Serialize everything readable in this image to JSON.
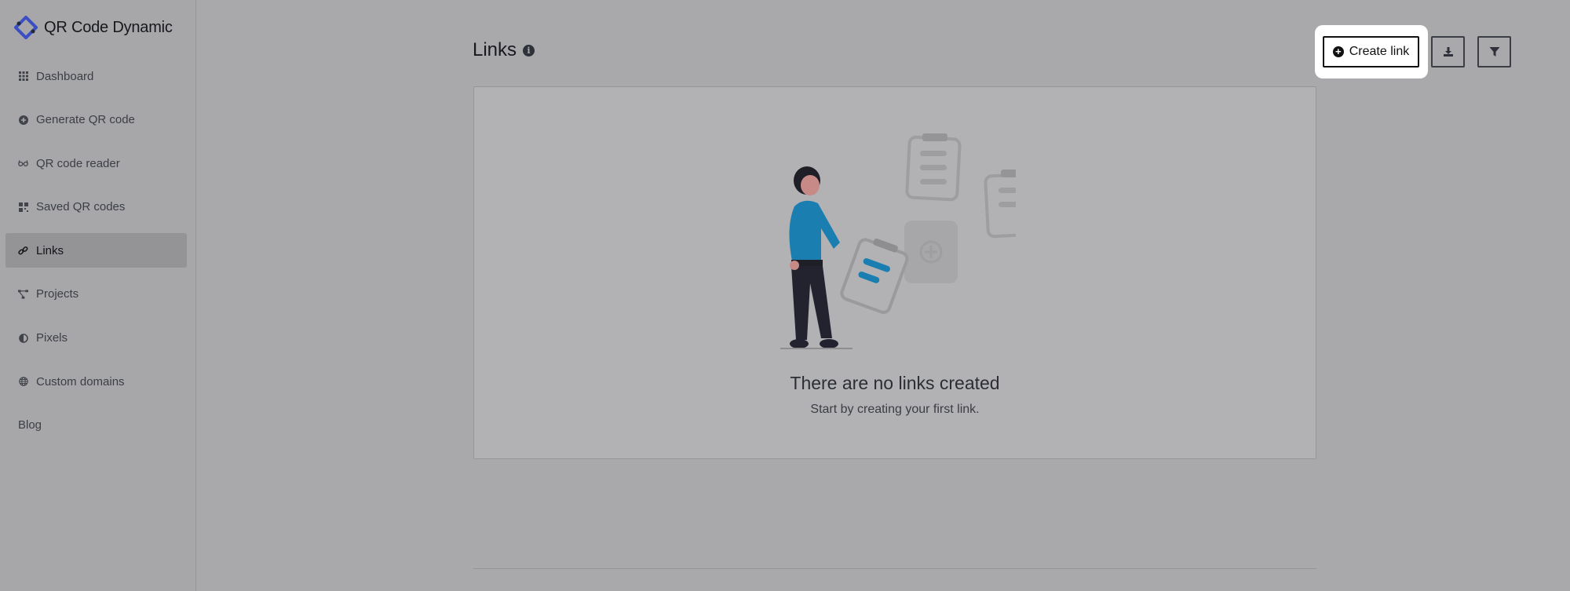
{
  "app": {
    "name": "QR Code Dynamic",
    "logo_icon": "qr-dynamic-logo-icon",
    "accent_color": "#3b4fc4"
  },
  "sidebar": {
    "items": [
      {
        "label": "Dashboard",
        "icon": "grid-icon",
        "active": false
      },
      {
        "label": "Generate QR code",
        "icon": "plus-circle-icon",
        "active": false
      },
      {
        "label": "QR code reader",
        "icon": "glasses-icon",
        "active": false
      },
      {
        "label": "Saved QR codes",
        "icon": "qr-icon",
        "active": false
      },
      {
        "label": "Links",
        "icon": "link-icon",
        "active": true
      },
      {
        "label": "Projects",
        "icon": "project-diagram-icon",
        "active": false
      },
      {
        "label": "Pixels",
        "icon": "adjust-icon",
        "active": false
      },
      {
        "label": "Custom domains",
        "icon": "globe-icon",
        "active": false
      },
      {
        "label": "Blog",
        "icon": "",
        "active": false
      }
    ]
  },
  "main": {
    "title": "Links",
    "create_button_label": "Create link",
    "download_icon": "download-icon",
    "filter_icon": "filter-icon",
    "empty_state": {
      "title": "There are no links created",
      "subtitle": "Start by creating your first link."
    }
  }
}
